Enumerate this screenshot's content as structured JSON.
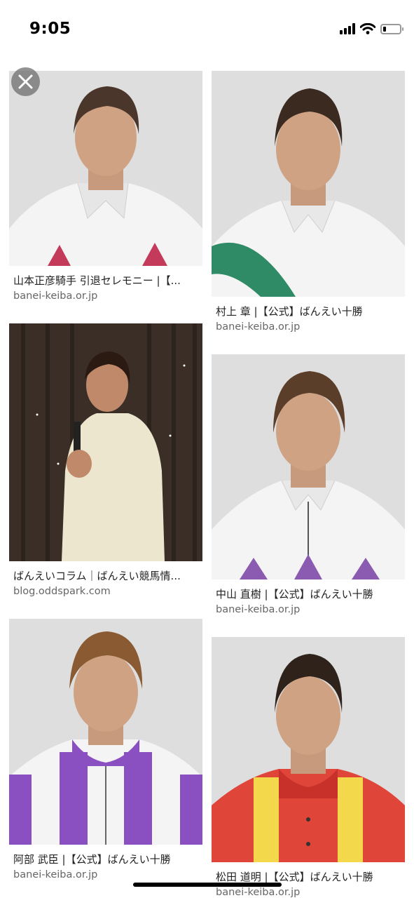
{
  "status_bar": {
    "time": "9:05",
    "battery_level": 0.2
  },
  "results": [
    {
      "caption": "山本正彦騎手 引退セレモニー |【...",
      "domain": "banei-keiba.or.jp"
    },
    {
      "caption": "村上 章 |【公式】ばんえい十勝",
      "domain": "banei-keiba.or.jp"
    },
    {
      "caption": "ばんえいコラム｜ばんえい競馬情...",
      "domain": "blog.oddspark.com"
    },
    {
      "caption": "中山 直樹 |【公式】ばんえい十勝",
      "domain": "banei-keiba.or.jp"
    },
    {
      "caption": "阿部 武臣 |【公式】ばんえい十勝",
      "domain": "banei-keiba.or.jp"
    },
    {
      "caption": "松田 道明 |【公式】ばんえい十勝",
      "domain": "banei-keiba.or.jp"
    }
  ],
  "icons": {
    "close": "close-icon",
    "signal": "cellular-signal-icon",
    "wifi": "wifi-icon",
    "battery": "battery-icon"
  }
}
